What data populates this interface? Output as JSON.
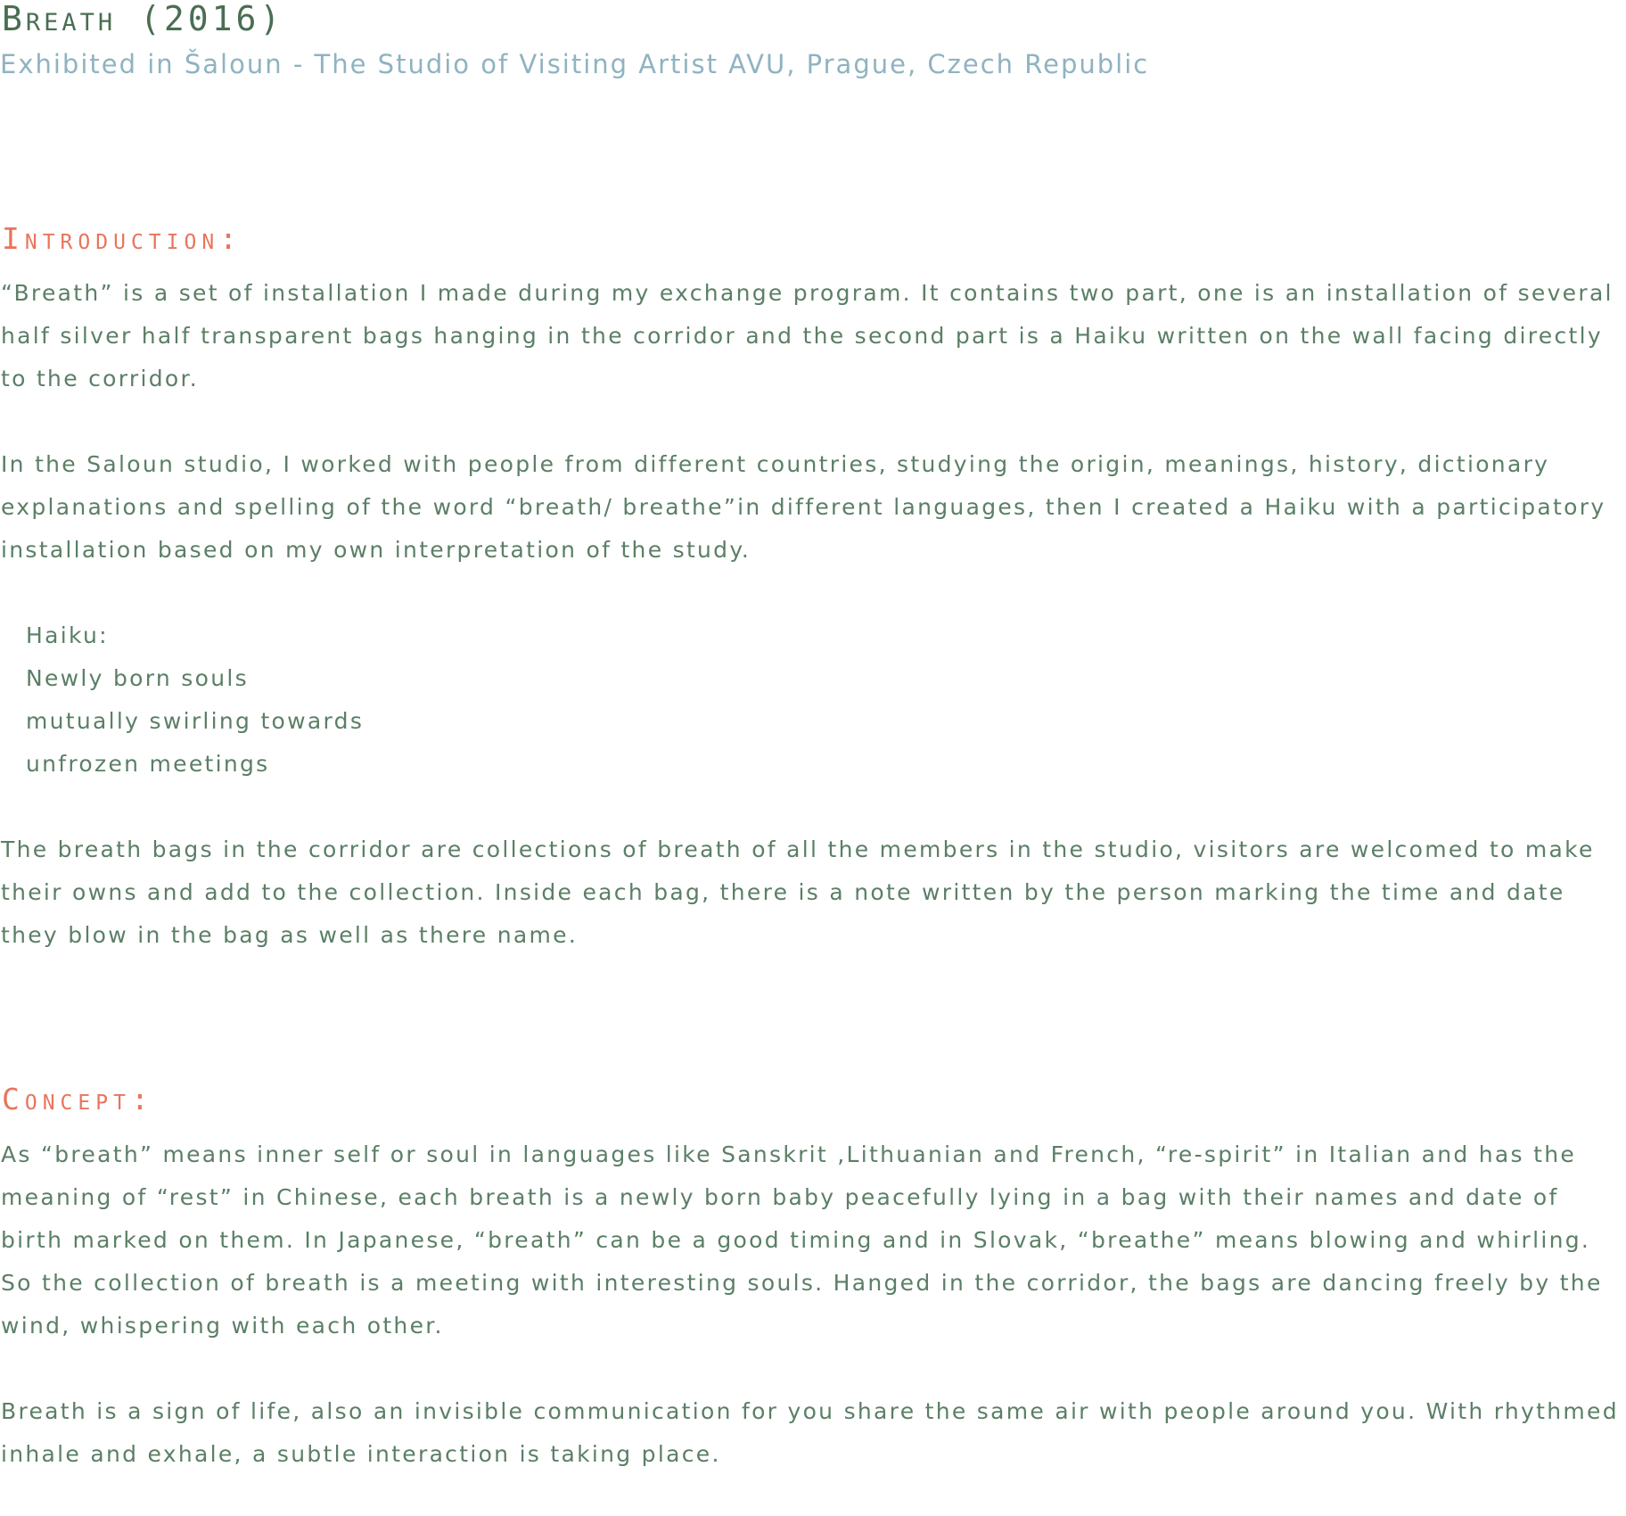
{
  "header": {
    "title": "Breath (2016)",
    "subtitle": "Exhibited in Šaloun - The Studio of Visiting Artist AVU, Prague, Czech Republic"
  },
  "introduction": {
    "heading": "Introduction:",
    "paragraph_1": "“Breath” is a set of installation I made during my exchange program. It contains two part, one is an installation of several half silver half transparent bags hanging in the corridor and the second part is a Haiku written on the wall facing directly to the corridor.",
    "paragraph_2": "In the Saloun studio, I worked with people from different countries, studying the origin, meanings, history, dictionary explanations and spelling of the word “breath/ breathe”in different languages, then I created a Haiku with a participatory installation based on my own interpretation of the study.",
    "haiku": {
      "label": "Haiku:",
      "line_1": "Newly born souls",
      "line_2": "mutually swirling towards",
      "line_3": "unfrozen meetings"
    },
    "paragraph_3": "The breath bags in the corridor are collections of breath of all the members in the studio, visitors are welcomed to make their owns and add to the collection. Inside each bag, there is a note written by the person marking the time and date they blow in the bag as well as there name."
  },
  "concept": {
    "heading": "Concept:",
    "paragraph_1": "As “breath” means inner self or soul in languages like Sanskrit ,Lithuanian and French, “re-spirit” in Italian and has the meaning of “rest” in Chinese, each breath is a newly born baby peacefully lying in a bag with their names and date of birth marked on them. In Japanese, “breath” can be a good timing and in Slovak, “breathe” means blowing and whirling. So the collection of breath is a meeting with interesting souls. Hanged in the corridor, the bags are dancing freely by the wind, whispering with each other.",
    "paragraph_2": "Breath is a sign of life, also an invisible communication for you share the same air with people around you. With rhythmed inhale and exhale, a subtle interaction is taking place."
  },
  "colors": {
    "title": "#4a6e52",
    "subtitle": "#8fb3c1",
    "heading_accent": "#e8755c",
    "body_text": "#5b7f66",
    "background": "#ffffff"
  }
}
